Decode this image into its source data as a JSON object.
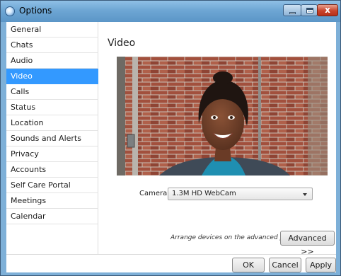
{
  "window": {
    "title": "Options",
    "app_icon": "app-icon",
    "controls": [
      "minimize-icon",
      "maximize-icon",
      "close-icon"
    ],
    "close_glyph": "x"
  },
  "sidebar": {
    "items": [
      {
        "label": "General"
      },
      {
        "label": "Chats"
      },
      {
        "label": "Audio"
      },
      {
        "label": "Video"
      },
      {
        "label": "Calls"
      },
      {
        "label": "Status"
      },
      {
        "label": "Location"
      },
      {
        "label": "Sounds and Alerts"
      },
      {
        "label": "Privacy"
      },
      {
        "label": "Accounts"
      },
      {
        "label": "Self Care Portal"
      },
      {
        "label": "Meetings"
      },
      {
        "label": "Calendar"
      }
    ],
    "selected": "Video",
    "selected_color": "#3399ff"
  },
  "content": {
    "title": "Video",
    "camera_label": "Camera:",
    "camera_value": "1.3M HD WebCam",
    "hint": "Arrange devices on the advanced page.",
    "advanced_label": "Advanced >>"
  },
  "footer": {
    "ok_label": "OK",
    "cancel_label": "Cancel",
    "apply_label": "Apply"
  },
  "colors": {
    "titlebar": "#6ea6d4",
    "close_button": "#c8432b"
  }
}
